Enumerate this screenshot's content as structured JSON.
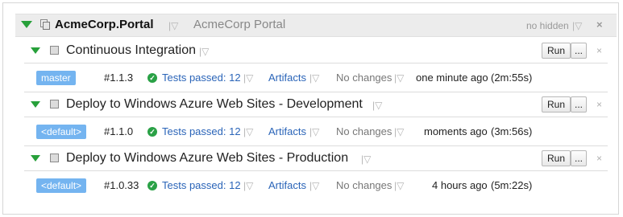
{
  "project": {
    "name": "AcmeCorp.Portal",
    "description": "AcmeCorp Portal",
    "hidden_label": "no hidden",
    "close_glyph": "×",
    "dropdown_glyph": "|▽"
  },
  "configs": [
    {
      "title": "Continuous Integration",
      "run_label": "Run",
      "more_label": "...",
      "remove_glyph": "×",
      "build": {
        "branch": "master",
        "number": "#1.1.3",
        "status": "Tests passed: 12",
        "artifacts": "Artifacts",
        "changes": "No changes",
        "when": "one minute ago",
        "duration": "(2m:55s)"
      }
    },
    {
      "title": "Deploy to Windows Azure Web Sites - Development",
      "run_label": "Run",
      "more_label": "...",
      "remove_glyph": "×",
      "build": {
        "branch": "<default>",
        "number": "#1.1.0",
        "status": "Tests passed: 12",
        "artifacts": "Artifacts",
        "changes": "No changes",
        "when": "moments ago",
        "duration": "(3m:56s)"
      }
    },
    {
      "title": "Deploy to Windows Azure Web Sites - Production",
      "run_label": "Run",
      "more_label": "...",
      "remove_glyph": "×",
      "build": {
        "branch": "<default>",
        "number": "#1.0.33",
        "status": "Tests passed: 12",
        "artifacts": "Artifacts",
        "changes": "No changes",
        "when": "4 hours ago",
        "duration": "(5m:22s)"
      }
    }
  ],
  "colors": {
    "success_green": "#27a03a",
    "link_blue": "#2a64b8",
    "branch_blue": "#74b4f0",
    "header_gray": "#ececec"
  },
  "icons": {
    "collapse": "collapse-triangle-icon",
    "project": "project-icon",
    "config": "build-config-icon",
    "success": "success-check-icon"
  }
}
